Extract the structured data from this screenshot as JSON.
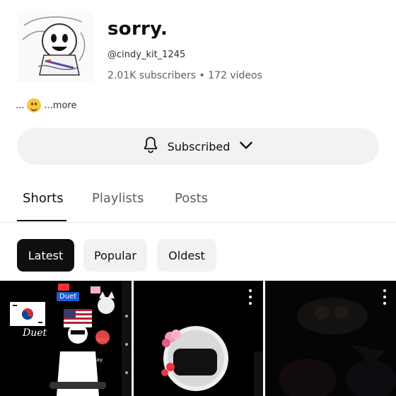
{
  "channel": {
    "name": "sorry.",
    "handle": "@cindy_kit_1245",
    "stats": "2.01K subscribers • 172 videos",
    "description_suffix": "...more"
  },
  "subscribe_button": {
    "label": "Subscribed"
  },
  "tabs": [
    {
      "label": "Shorts",
      "active": true
    },
    {
      "label": "Playlists",
      "active": false
    },
    {
      "label": "Posts",
      "active": false
    }
  ],
  "chips": [
    {
      "label": "Latest",
      "active": true
    },
    {
      "label": "Popular",
      "active": false
    },
    {
      "label": "Oldest",
      "active": false
    }
  ],
  "shorts": [
    {
      "overlay_text": "Duet",
      "badge_text": "Duet",
      "small_texts": [
        "Don't say",
        "Why?"
      ]
    },
    {},
    {}
  ],
  "colors": {
    "accent": "#0f0f0f",
    "chip_bg": "#f2f2f2",
    "page_bg": "#ffffff"
  },
  "icons": [
    "bell-icon",
    "chevron-down-icon",
    "more-vert-icon",
    "smiley-emoji"
  ]
}
